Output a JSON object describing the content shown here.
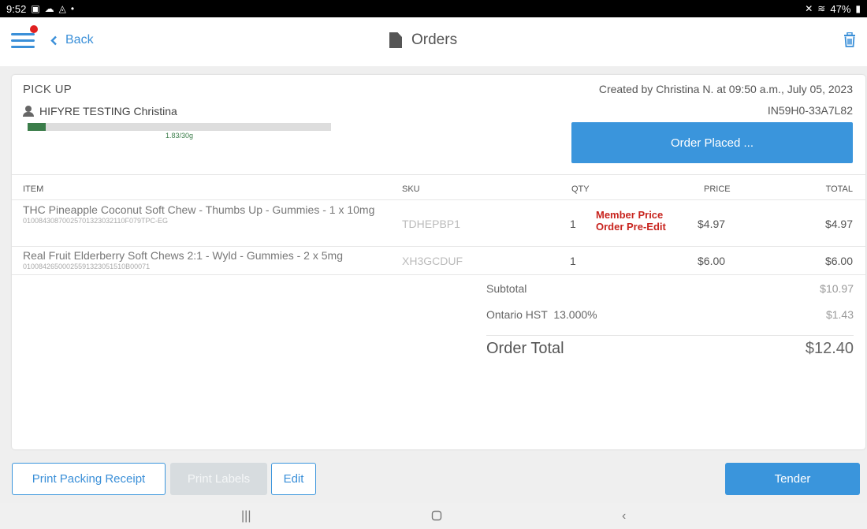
{
  "status_bar": {
    "time": "9:52",
    "battery": "47%"
  },
  "header": {
    "back_label": "Back",
    "title": "Orders"
  },
  "order": {
    "type": "PICK UP",
    "customer": "HIFYRE TESTING Christina",
    "limit_text": "1.83/30g",
    "limit_fraction": 0.061,
    "created": "Created by Christina N. at 09:50 a.m., July 05, 2023",
    "order_number": "IN59H0-33A7L82",
    "status_label": "Order Placed ..."
  },
  "table": {
    "headers": {
      "item": "ITEM",
      "sku": "SKU",
      "qty": "QTY",
      "price": "PRICE",
      "total": "TOTAL"
    },
    "rows": [
      {
        "name": "THC Pineapple Coconut Soft Chew - Thumbs Up - Gummies - 1 x 10mg",
        "code": "01008430870025701323032110F079TPC-EG",
        "sku": "TDHEPBP1",
        "qty": "1",
        "note_line1": "Member Price",
        "note_line2": "Order Pre-Edit",
        "price": "$4.97",
        "total": "$4.97"
      },
      {
        "name": "Real Fruit Elderberry Soft Chews 2:1 - Wyld - Gummies - 2 x 5mg",
        "code": "01008426500025591323051510B00071",
        "sku": "XH3GCDUF",
        "qty": "1",
        "price": "$6.00",
        "total": "$6.00"
      }
    ]
  },
  "summary": {
    "subtotal_label": "Subtotal",
    "subtotal": "$10.97",
    "tax_label": "Ontario HST  13.000%",
    "tax": "$1.43",
    "total_label": "Order Total",
    "total": "$12.40"
  },
  "actions": {
    "print_packing": "Print Packing Receipt",
    "print_labels": "Print Labels",
    "edit": "Edit",
    "tender": "Tender"
  },
  "colors": {
    "accent": "#3a95dc",
    "limit_fill": "#3b7d4a",
    "note_red": "#c8241e",
    "badge_red": "#e02020"
  }
}
